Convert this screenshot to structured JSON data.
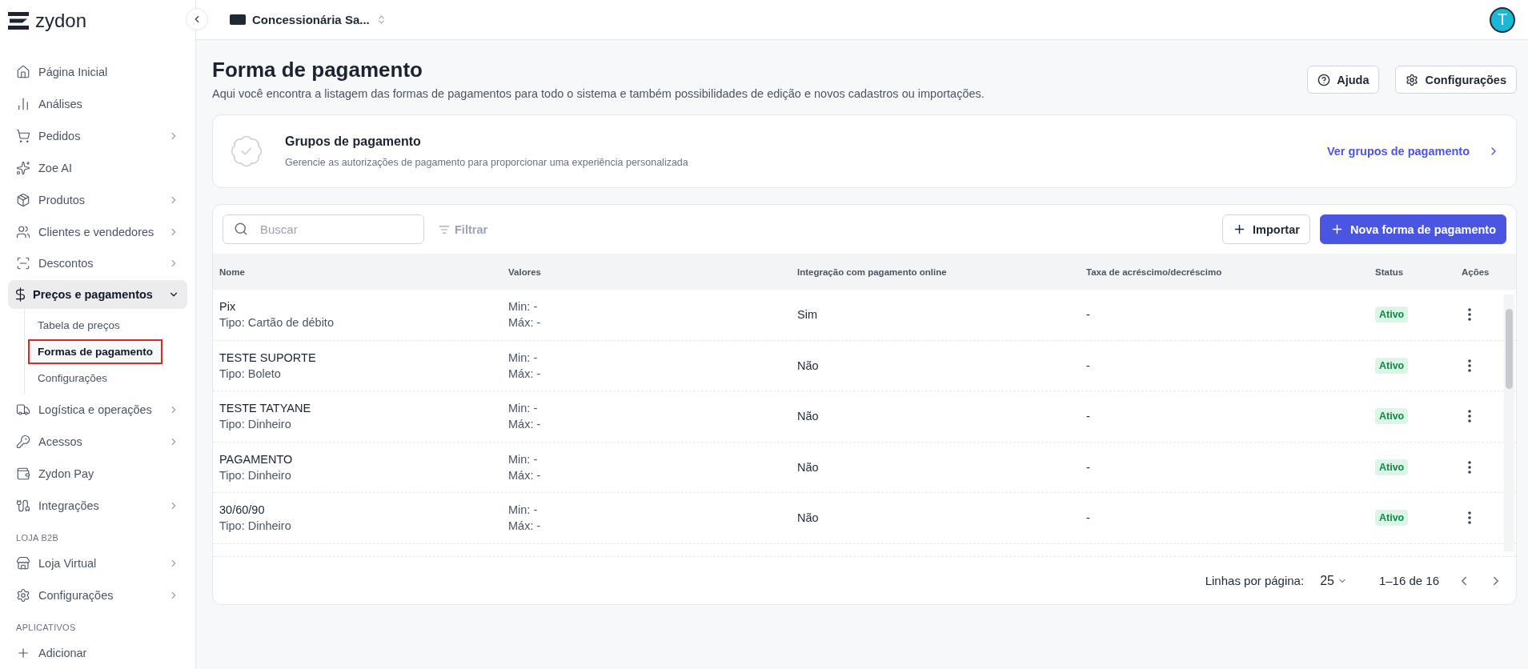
{
  "brand": "zydon",
  "nav": [
    {
      "kind": "item",
      "label": "Página Inicial",
      "submenu": false,
      "expanded": false,
      "selected": false
    },
    {
      "kind": "item",
      "label": "Análises",
      "submenu": false,
      "expanded": false,
      "selected": false
    },
    {
      "kind": "item",
      "label": "Pedidos",
      "submenu": true,
      "expanded": false,
      "selected": false
    },
    {
      "kind": "item",
      "label": "Zoe AI",
      "submenu": false,
      "expanded": false,
      "selected": false
    },
    {
      "kind": "item",
      "label": "Produtos",
      "submenu": true,
      "expanded": false,
      "selected": false
    },
    {
      "kind": "item",
      "label": "Clientes e vendedores",
      "submenu": true,
      "expanded": false,
      "selected": false
    },
    {
      "kind": "item",
      "label": "Descontos",
      "submenu": true,
      "expanded": false,
      "selected": false
    },
    {
      "kind": "item",
      "label": "Preços e pagamentos",
      "submenu": true,
      "expanded": true,
      "selected": true,
      "children": [
        {
          "label": "Tabela de preços",
          "selected": false
        },
        {
          "label": "Formas de pagamento",
          "selected": true
        },
        {
          "label": "Configurações",
          "selected": false
        }
      ]
    },
    {
      "kind": "item",
      "label": "Logística e operações",
      "submenu": true,
      "expanded": false,
      "selected": false
    },
    {
      "kind": "item",
      "label": "Acessos",
      "submenu": true,
      "expanded": false,
      "selected": false
    },
    {
      "kind": "item",
      "label": "Zydon Pay",
      "submenu": false,
      "expanded": false,
      "selected": false
    },
    {
      "kind": "item",
      "label": "Integrações",
      "submenu": true,
      "expanded": false,
      "selected": false
    },
    {
      "kind": "section",
      "label": "LOJA B2B"
    },
    {
      "kind": "item",
      "label": "Loja Virtual",
      "submenu": true,
      "expanded": false,
      "selected": false
    },
    {
      "kind": "item",
      "label": "Configurações",
      "submenu": true,
      "expanded": false,
      "selected": false
    },
    {
      "kind": "section",
      "label": "APLICATIVOS"
    },
    {
      "kind": "item",
      "label": "Adicionar",
      "submenu": false,
      "expanded": false,
      "selected": false
    }
  ],
  "topbar": {
    "company": "Concessionária Sa...",
    "avatar": "T"
  },
  "page": {
    "title": "Forma de pagamento",
    "subtitle": "Aqui você encontra a listagem das formas de pagamentos para todo o sistema e também possibilidades de edição e novos cadastros ou importações.",
    "actions": [
      "Ajuda",
      "Configurações"
    ]
  },
  "groups_card": {
    "title": "Grupos de pagamento",
    "description": "Gerencie as autorizações de pagamento para proporcionar uma experiência personalizada",
    "link": "Ver grupos de pagamento"
  },
  "toolbar": {
    "search_placeholder": "Buscar",
    "filter": "Filtrar",
    "import": "Importar",
    "new": "Nova forma de pagamento"
  },
  "table": {
    "columns": [
      "Nome",
      "Valores",
      "Integração com pagamento online",
      "Taxa de acréscimo/decréscimo",
      "Status",
      "Ações"
    ],
    "rows": [
      {
        "name": "Pix",
        "type": "Tipo: Cartão de débito",
        "min": "Min: -",
        "max": "Máx: -",
        "online": "Sim",
        "fee": "-",
        "status": "Ativo"
      },
      {
        "name": "TESTE SUPORTE",
        "type": "Tipo: Boleto",
        "min": "Min: -",
        "max": "Máx: -",
        "online": "Não",
        "fee": "-",
        "status": "Ativo"
      },
      {
        "name": "TESTE TATYANE",
        "type": "Tipo: Dinheiro",
        "min": "Min: -",
        "max": "Máx: -",
        "online": "Não",
        "fee": "-",
        "status": "Ativo"
      },
      {
        "name": "PAGAMENTO",
        "type": "Tipo: Dinheiro",
        "min": "Min: -",
        "max": "Máx: -",
        "online": "Não",
        "fee": "-",
        "status": "Ativo"
      },
      {
        "name": "30/60/90",
        "type": "Tipo: Dinheiro",
        "min": "Min: -",
        "max": "Máx: -",
        "online": "Não",
        "fee": "-",
        "status": "Ativo"
      }
    ]
  },
  "pagination": {
    "rows_label": "Linhas por página:",
    "rows_value": "25",
    "range": "1–16 de 16"
  }
}
